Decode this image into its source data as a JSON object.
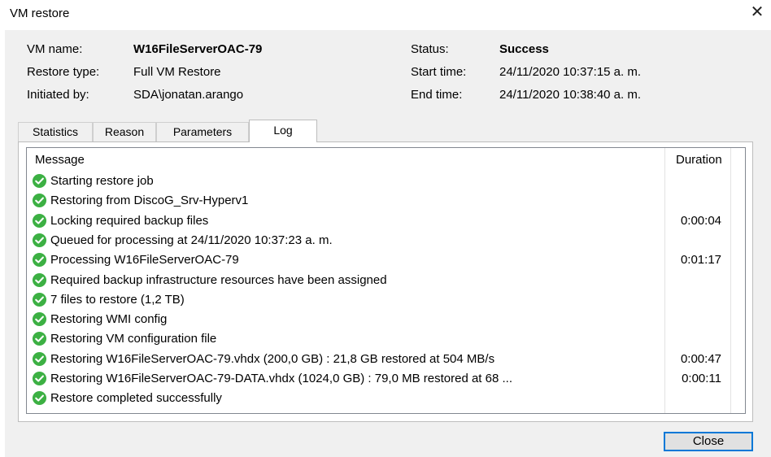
{
  "window": {
    "title": "VM restore"
  },
  "info": {
    "vm_name_label": "VM name:",
    "vm_name": "W16FileServerOAC-79",
    "restore_type_label": "Restore type:",
    "restore_type": "Full VM Restore",
    "initiated_by_label": "Initiated by:",
    "initiated_by": "SDA\\jonatan.arango",
    "status_label": "Status:",
    "status": "Success",
    "start_time_label": "Start time:",
    "start_time": "24/11/2020 10:37:15 a. m.",
    "end_time_label": "End time:",
    "end_time": "24/11/2020 10:38:40 a. m."
  },
  "tabs": [
    "Statistics",
    "Reason",
    "Parameters",
    "Log"
  ],
  "active_tab": "Log",
  "log": {
    "columns": {
      "message": "Message",
      "duration": "Duration"
    },
    "rows": [
      {
        "message": "Starting restore job",
        "duration": ""
      },
      {
        "message": "Restoring from DiscoG_Srv-Hyperv1",
        "duration": ""
      },
      {
        "message": "Locking required backup files",
        "duration": "0:00:04"
      },
      {
        "message": "Queued for processing at 24/11/2020 10:37:23 a. m.",
        "duration": ""
      },
      {
        "message": "Processing W16FileServerOAC-79",
        "duration": "0:01:17"
      },
      {
        "message": "Required backup infrastructure resources have been assigned",
        "duration": ""
      },
      {
        "message": "7 files to restore (1,2 TB)",
        "duration": ""
      },
      {
        "message": "Restoring WMI config",
        "duration": ""
      },
      {
        "message": "Restoring VM configuration file",
        "duration": ""
      },
      {
        "message": "Restoring W16FileServerOAC-79.vhdx (200,0 GB) : 21,8 GB restored at 504 MB/s",
        "duration": "0:00:47"
      },
      {
        "message": "Restoring W16FileServerOAC-79-DATA.vhdx (1024,0 GB) : 79,0 MB restored at 68 ...",
        "duration": "0:00:11"
      },
      {
        "message": "Restore completed successfully",
        "duration": ""
      }
    ]
  },
  "buttons": {
    "close": "Close"
  },
  "icons": {
    "row_status": "success-check-icon",
    "window_close": "close-icon"
  },
  "colors": {
    "success": "#3cb043",
    "focus": "#0078d7"
  }
}
